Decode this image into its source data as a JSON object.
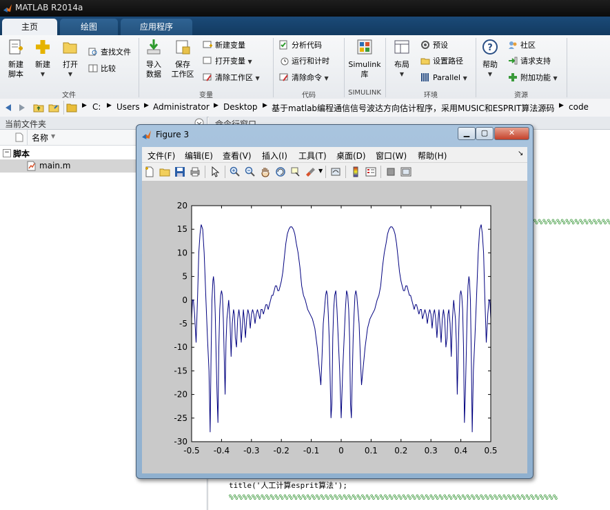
{
  "app": {
    "title": "MATLAB R2014a"
  },
  "tabs": [
    {
      "label": "主页",
      "active": true
    },
    {
      "label": "绘图",
      "active": false
    },
    {
      "label": "应用程序",
      "active": false
    }
  ],
  "ribbon": {
    "file_group": {
      "label": "文件",
      "new_script": "新建\n脚本",
      "new": "新建",
      "open": "打开",
      "find_files": "查找文件",
      "compare": "比较"
    },
    "variable_group": {
      "label": "变量",
      "import_data": "导入\n数据",
      "save_workspace": "保存\n工作区",
      "new_variable": "新建变量",
      "open_variable": "打开变量",
      "clear_workspace": "清除工作区"
    },
    "code_group": {
      "label": "代码",
      "analyze_code": "分析代码",
      "run_and_time": "运行和计时",
      "clear_commands": "清除命令"
    },
    "simulink_group": {
      "label": "SIMULINK",
      "simulink_library": "Simulink\n库"
    },
    "environment_group": {
      "label": "环境",
      "layout": "布局",
      "preferences": "预设",
      "set_path": "设置路径",
      "parallel": "Parallel"
    },
    "resources_group": {
      "label": "资源",
      "help": "帮助",
      "community": "社区",
      "request_support": "请求支持",
      "add_ons": "附加功能"
    }
  },
  "address_bar": {
    "crumbs": [
      "C:",
      "Users",
      "Administrator",
      "Desktop",
      "基于matlab编程通信信号波达方向估计程序，采用MUSIC和ESPRIT算法源码",
      "code"
    ]
  },
  "current_folder": {
    "title": "当前文件夹",
    "column_name": "名称",
    "group": "脚本",
    "file": "main.m"
  },
  "command_window": {
    "title": "命令行窗口",
    "line_title": "title('人工计算esprit算法');",
    "line_percent": "%%%%%%%%%%%%%%%%%%%%%%%%%%%%%%%%%%%%%%%%%%%%%%%%%%%%%%%%%%%%%%%%%%%%%%%%",
    "line_percent_short": "%%%%%%%%%%%%%%%%%%%%%%%"
  },
  "figure": {
    "title": "Figure 3",
    "menus": [
      "文件(F)",
      "编辑(E)",
      "查看(V)",
      "插入(I)",
      "工具(T)",
      "桌面(D)",
      "窗口(W)",
      "帮助(H)"
    ],
    "colors": {
      "line": "#00007f",
      "axes_bg": "#ffffff",
      "figure_bg": "#c9c9c9"
    }
  },
  "chart_data": {
    "type": "line",
    "title": "",
    "xlabel": "",
    "ylabel": "",
    "xlim": [
      -0.5,
      0.5
    ],
    "ylim": [
      -30,
      20
    ],
    "xticks": [
      "-0.5",
      "-0.4",
      "-0.3",
      "-0.2",
      "-0.1",
      "0",
      "0.1",
      "0.2",
      "0.3",
      "0.4",
      "0.5"
    ],
    "yticks": [
      "20",
      "15",
      "10",
      "5",
      "0",
      "-5",
      "-10",
      "-15",
      "-20",
      "-25",
      "-30"
    ],
    "grid": false,
    "series": [
      {
        "color": "#00007f",
        "x": [
          -0.5,
          -0.497,
          -0.494,
          -0.49,
          -0.485,
          -0.48,
          -0.476,
          -0.472,
          -0.468,
          -0.463,
          -0.458,
          -0.452,
          -0.447,
          -0.442,
          -0.438,
          -0.435,
          -0.432,
          -0.429,
          -0.427,
          -0.424,
          -0.421,
          -0.418,
          -0.415,
          -0.412,
          -0.409,
          -0.406,
          -0.403,
          -0.4,
          -0.397,
          -0.394,
          -0.391,
          -0.388,
          -0.385,
          -0.382,
          -0.379,
          -0.376,
          -0.372,
          -0.368,
          -0.364,
          -0.36,
          -0.357,
          -0.354,
          -0.35,
          -0.346,
          -0.342,
          -0.338,
          -0.334,
          -0.33,
          -0.327,
          -0.324,
          -0.32,
          -0.316,
          -0.312,
          -0.308,
          -0.304,
          -0.3,
          -0.296,
          -0.292,
          -0.288,
          -0.284,
          -0.28,
          -0.276,
          -0.272,
          -0.268,
          -0.264,
          -0.26,
          -0.256,
          -0.252,
          -0.248,
          -0.244,
          -0.24,
          -0.236,
          -0.232,
          -0.228,
          -0.224,
          -0.22,
          -0.216,
          -0.212,
          -0.208,
          -0.204,
          -0.2,
          -0.195,
          -0.19,
          -0.185,
          -0.18,
          -0.175,
          -0.17,
          -0.165,
          -0.16,
          -0.155,
          -0.15,
          -0.144,
          -0.138,
          -0.132,
          -0.126,
          -0.12,
          -0.112,
          -0.104,
          -0.096,
          -0.088,
          -0.08,
          -0.074,
          -0.068,
          -0.064,
          -0.06,
          -0.056,
          -0.052,
          -0.049,
          -0.046,
          -0.043,
          -0.04,
          -0.037,
          -0.034,
          -0.031,
          -0.028,
          -0.025,
          -0.022,
          -0.018,
          -0.014,
          -0.01,
          -0.005,
          0.0,
          0.005,
          0.01,
          0.014,
          0.018,
          0.022,
          0.025,
          0.028,
          0.031,
          0.034,
          0.037,
          0.04,
          0.043,
          0.046,
          0.049,
          0.052,
          0.056,
          0.06,
          0.064,
          0.068,
          0.074,
          0.08,
          0.088,
          0.096,
          0.104,
          0.112,
          0.12,
          0.126,
          0.132,
          0.138,
          0.144,
          0.15,
          0.155,
          0.16,
          0.165,
          0.17,
          0.175,
          0.18,
          0.185,
          0.19,
          0.195,
          0.2,
          0.204,
          0.208,
          0.212,
          0.216,
          0.22,
          0.224,
          0.228,
          0.232,
          0.236,
          0.24,
          0.244,
          0.248,
          0.252,
          0.256,
          0.26,
          0.264,
          0.268,
          0.272,
          0.276,
          0.28,
          0.284,
          0.288,
          0.292,
          0.296,
          0.3,
          0.304,
          0.308,
          0.312,
          0.316,
          0.32,
          0.324,
          0.327,
          0.33,
          0.334,
          0.338,
          0.342,
          0.346,
          0.35,
          0.354,
          0.357,
          0.36,
          0.364,
          0.368,
          0.372,
          0.376,
          0.379,
          0.382,
          0.385,
          0.388,
          0.391,
          0.394,
          0.397,
          0.4,
          0.403,
          0.406,
          0.409,
          0.412,
          0.415,
          0.418,
          0.421,
          0.424,
          0.427,
          0.429,
          0.432,
          0.435,
          0.438,
          0.442,
          0.447,
          0.452,
          0.458,
          0.463,
          0.468,
          0.472,
          0.476,
          0.48,
          0.485,
          0.49,
          0.494,
          0.497,
          0.5
        ],
        "y": [
          -4,
          0,
          0,
          -3,
          -9,
          1,
          10,
          14,
          16,
          15,
          10,
          0,
          -8,
          -15,
          -28,
          -12,
          0,
          4,
          5,
          3,
          -3,
          -12,
          -20,
          -26,
          -10,
          -2,
          1,
          2,
          1,
          -4,
          -12,
          -20,
          -9,
          -4,
          -2,
          0,
          -4,
          -12,
          -5,
          -2,
          -3,
          -8,
          -10,
          -4,
          -2,
          -4,
          -9,
          -5,
          -2,
          -4,
          -8,
          -4,
          -2,
          -3,
          -6,
          -3,
          -2,
          -3,
          -5,
          -3,
          -2,
          -3,
          -4,
          -2,
          -2,
          -3,
          -2,
          -1,
          -1,
          -2,
          -1,
          0,
          1,
          1,
          2,
          3,
          3,
          2,
          2,
          3,
          4,
          6,
          9,
          12,
          14,
          15,
          15.5,
          15.5,
          15,
          14,
          12,
          10,
          7,
          3,
          1,
          0,
          -2,
          -3,
          -4,
          -6,
          -10,
          -14,
          -18,
          -12,
          -5,
          -2,
          1,
          2,
          1,
          -3,
          -8,
          -16,
          -25,
          -22,
          -8,
          -2,
          1,
          2,
          -2,
          -8,
          -15,
          -25,
          -15,
          -8,
          -2,
          2,
          1,
          -2,
          -8,
          -22,
          -25,
          -16,
          -8,
          -3,
          1,
          2,
          1,
          -2,
          -5,
          -12,
          -18,
          -14,
          -10,
          -6,
          -4,
          -3,
          -2,
          0,
          1,
          3,
          7,
          10,
          12,
          14,
          15,
          15.5,
          15.5,
          15,
          14,
          12,
          9,
          6,
          4,
          3,
          2,
          2,
          3,
          3,
          2,
          1,
          1,
          0,
          -1,
          -2,
          -1,
          -1,
          -2,
          -3,
          -2,
          -2,
          -4,
          -3,
          -2,
          -3,
          -5,
          -3,
          -2,
          -3,
          -6,
          -3,
          -2,
          -4,
          -8,
          -4,
          -2,
          -5,
          -9,
          -4,
          -2,
          -4,
          -10,
          -8,
          -3,
          -2,
          -5,
          -12,
          -4,
          0,
          -2,
          -4,
          -9,
          -20,
          -12,
          -4,
          1,
          2,
          1,
          -2,
          -10,
          -26,
          -20,
          -12,
          -3,
          3,
          5,
          4,
          0,
          -12,
          -28,
          -15,
          -8,
          0,
          10,
          15,
          16,
          14,
          10,
          1,
          -9,
          -3,
          0,
          0,
          -4
        ]
      }
    ]
  }
}
